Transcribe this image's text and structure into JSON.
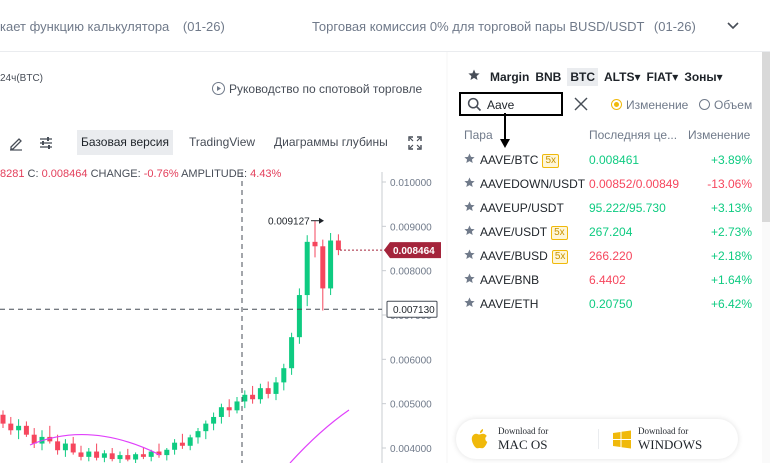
{
  "announcements": {
    "left_text": "кает функцию калькулятора",
    "left_date": "(01-26)",
    "right_text": "Торговая комиссия 0% для торговой пары BUSD/USDT",
    "right_date": "(01-26)"
  },
  "chart_header": {
    "volume_label": "24ч(BTC)",
    "guide_link": "Руководство по спотовой торговле",
    "tabs": [
      "Базовая версия",
      "TradingView",
      "Диаграммы глубины"
    ]
  },
  "ohlc": {
    "h_val": "8281",
    "c_label": "C:",
    "c_val": "0.008464",
    "change_label": "CHANGE:",
    "change_val": "-0.76%",
    "amp_label": "AMPLITUDE:",
    "amp_val": "4.43%"
  },
  "chart_data": {
    "type": "candlestick",
    "y_ticks": [
      "0.010000",
      "0.009000",
      "0.008000",
      "0.007000",
      "0.006000",
      "0.005000",
      "0.004000"
    ],
    "ylim": [
      0.0037,
      0.0102
    ],
    "high_annotation": "0.009127",
    "current_price_label": "0.008464",
    "crosshair_price_label": "0.007130",
    "candles": [
      {
        "o": 0.00475,
        "h": 0.00485,
        "l": 0.00445,
        "c": 0.00455
      },
      {
        "o": 0.00455,
        "h": 0.0047,
        "l": 0.0043,
        "c": 0.0044
      },
      {
        "o": 0.0044,
        "h": 0.00465,
        "l": 0.0042,
        "c": 0.0045
      },
      {
        "o": 0.0045,
        "h": 0.0046,
        "l": 0.00425,
        "c": 0.0043
      },
      {
        "o": 0.0043,
        "h": 0.00445,
        "l": 0.004,
        "c": 0.0041
      },
      {
        "o": 0.0041,
        "h": 0.0044,
        "l": 0.00395,
        "c": 0.00425
      },
      {
        "o": 0.00425,
        "h": 0.0045,
        "l": 0.0041,
        "c": 0.00415
      },
      {
        "o": 0.00415,
        "h": 0.0043,
        "l": 0.00385,
        "c": 0.00395
      },
      {
        "o": 0.00395,
        "h": 0.0042,
        "l": 0.0038,
        "c": 0.0041
      },
      {
        "o": 0.0041,
        "h": 0.00425,
        "l": 0.00385,
        "c": 0.0039
      },
      {
        "o": 0.0039,
        "h": 0.00405,
        "l": 0.00372,
        "c": 0.0038
      },
      {
        "o": 0.0038,
        "h": 0.004,
        "l": 0.0037,
        "c": 0.00392
      },
      {
        "o": 0.00392,
        "h": 0.0041,
        "l": 0.00372,
        "c": 0.00378
      },
      {
        "o": 0.00378,
        "h": 0.00395,
        "l": 0.00368,
        "c": 0.00388
      },
      {
        "o": 0.00388,
        "h": 0.004,
        "l": 0.0037,
        "c": 0.00375
      },
      {
        "o": 0.00375,
        "h": 0.00392,
        "l": 0.00366,
        "c": 0.00384
      },
      {
        "o": 0.00384,
        "h": 0.00398,
        "l": 0.0037,
        "c": 0.00374
      },
      {
        "o": 0.00374,
        "h": 0.0039,
        "l": 0.00365,
        "c": 0.00386
      },
      {
        "o": 0.00386,
        "h": 0.00402,
        "l": 0.00375,
        "c": 0.0038
      },
      {
        "o": 0.0038,
        "h": 0.00396,
        "l": 0.0037,
        "c": 0.00392
      },
      {
        "o": 0.00392,
        "h": 0.0041,
        "l": 0.00378,
        "c": 0.00384
      },
      {
        "o": 0.00384,
        "h": 0.004,
        "l": 0.00372,
        "c": 0.00396
      },
      {
        "o": 0.00396,
        "h": 0.0042,
        "l": 0.00385,
        "c": 0.00412
      },
      {
        "o": 0.00412,
        "h": 0.00432,
        "l": 0.00398,
        "c": 0.00405
      },
      {
        "o": 0.00405,
        "h": 0.0043,
        "l": 0.00395,
        "c": 0.00424
      },
      {
        "o": 0.00424,
        "h": 0.00445,
        "l": 0.0041,
        "c": 0.00438
      },
      {
        "o": 0.00438,
        "h": 0.00462,
        "l": 0.0042,
        "c": 0.00455
      },
      {
        "o": 0.00455,
        "h": 0.0048,
        "l": 0.0044,
        "c": 0.0047
      },
      {
        "o": 0.0047,
        "h": 0.005,
        "l": 0.00455,
        "c": 0.00492
      },
      {
        "o": 0.00492,
        "h": 0.0051,
        "l": 0.0047,
        "c": 0.00485
      },
      {
        "o": 0.00485,
        "h": 0.00515,
        "l": 0.00478,
        "c": 0.00505
      },
      {
        "o": 0.00505,
        "h": 0.0053,
        "l": 0.0049,
        "c": 0.0052
      },
      {
        "o": 0.0052,
        "h": 0.0054,
        "l": 0.005,
        "c": 0.0051
      },
      {
        "o": 0.0051,
        "h": 0.00545,
        "l": 0.005,
        "c": 0.00535
      },
      {
        "o": 0.00535,
        "h": 0.0055,
        "l": 0.00512,
        "c": 0.00522
      },
      {
        "o": 0.00522,
        "h": 0.0056,
        "l": 0.00508,
        "c": 0.00548
      },
      {
        "o": 0.00548,
        "h": 0.0059,
        "l": 0.0053,
        "c": 0.0058
      },
      {
        "o": 0.0058,
        "h": 0.0066,
        "l": 0.00565,
        "c": 0.0065
      },
      {
        "o": 0.0065,
        "h": 0.0076,
        "l": 0.00635,
        "c": 0.00745
      },
      {
        "o": 0.00745,
        "h": 0.0088,
        "l": 0.0072,
        "c": 0.00865
      },
      {
        "o": 0.00865,
        "h": 0.009127,
        "l": 0.0083,
        "c": 0.00855
      },
      {
        "o": 0.00855,
        "h": 0.0087,
        "l": 0.0071,
        "c": 0.0076
      },
      {
        "o": 0.0076,
        "h": 0.00885,
        "l": 0.00745,
        "c": 0.00868
      },
      {
        "o": 0.00868,
        "h": 0.00882,
        "l": 0.00835,
        "c": 0.008464
      }
    ]
  },
  "market": {
    "tabs": [
      "Margin",
      "BNB",
      "BTC",
      "ALTS",
      "FIAT",
      "Зоны"
    ],
    "search_value": "Aave",
    "radio_change": "Изменение",
    "radio_volume": "Объем",
    "col_pair": "Пара",
    "col_price": "Последняя це...",
    "col_change": "Изменение",
    "rows": [
      {
        "pair": "AAVE/BTC",
        "lev": "5x",
        "price": "0.008461",
        "change": "+3.89%",
        "price_dir": "up",
        "change_dir": "up"
      },
      {
        "pair": "AAVEDOWN/USDT",
        "lev": "",
        "price": "0.00852/0.00849",
        "change": "-13.06%",
        "price_dir": "down",
        "change_dir": "down"
      },
      {
        "pair": "AAVEUP/USDT",
        "lev": "",
        "price": "95.222/95.730",
        "change": "+3.13%",
        "price_dir": "up",
        "change_dir": "up"
      },
      {
        "pair": "AAVE/USDT",
        "lev": "5x",
        "price": "267.204",
        "change": "+2.73%",
        "price_dir": "up",
        "change_dir": "up"
      },
      {
        "pair": "AAVE/BUSD",
        "lev": "5x",
        "price": "266.220",
        "change": "+2.18%",
        "price_dir": "down",
        "change_dir": "up"
      },
      {
        "pair": "AAVE/BNB",
        "lev": "",
        "price": "6.4402",
        "change": "+1.64%",
        "price_dir": "down",
        "change_dir": "up"
      },
      {
        "pair": "AAVE/ETH",
        "lev": "",
        "price": "0.20750",
        "change": "+6.42%",
        "price_dir": "up",
        "change_dir": "up"
      }
    ]
  },
  "downloads": {
    "mac_small": "Download for",
    "mac_big": "MAC OS",
    "win_small": "Download for",
    "win_big": "WINDOWS"
  },
  "colors": {
    "up": "#0ecb81",
    "down": "#f6465d",
    "accent": "#f0b90b",
    "price_tag": "#a4243b",
    "ma_line": "#e040fb"
  }
}
